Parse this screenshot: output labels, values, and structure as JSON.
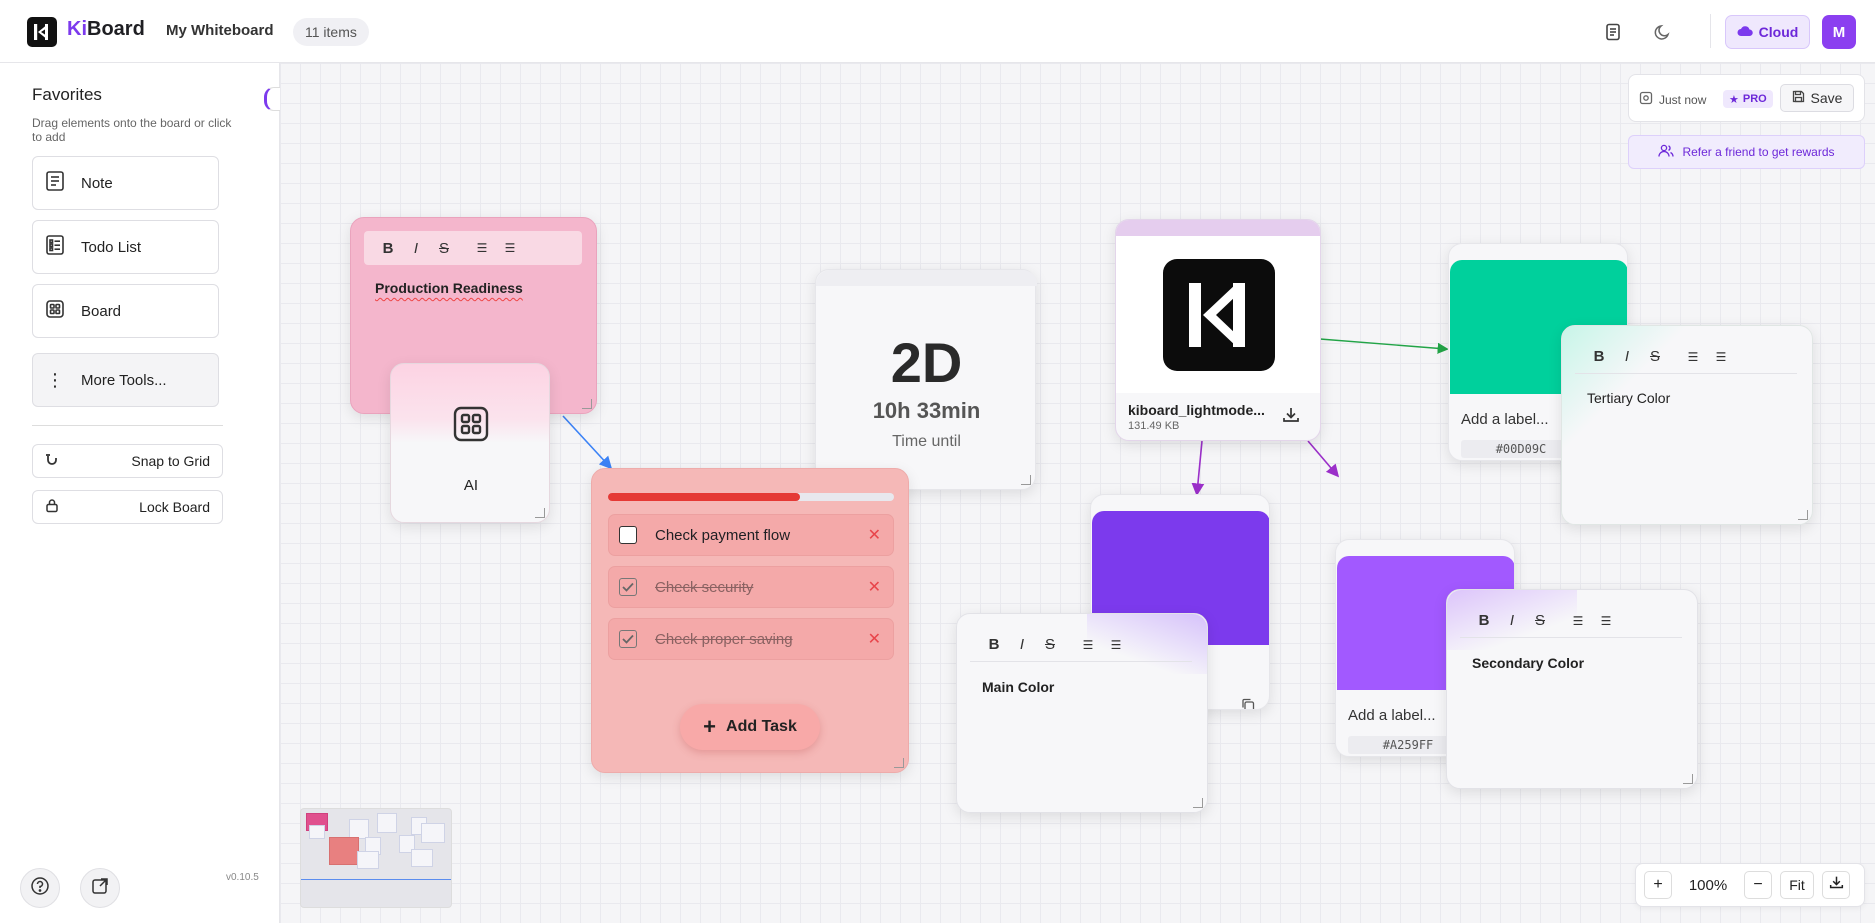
{
  "header": {
    "brand_ki": "Ki",
    "brand_rest": "Board",
    "board_name": "My Whiteboard",
    "items_count": "11 items",
    "cloud_label": "Cloud",
    "avatar_initial": "M"
  },
  "sidebar": {
    "title": "Favorites",
    "hint": "Drag elements onto the board or click to add",
    "tools": [
      {
        "label": "Note",
        "icon": "note-icon"
      },
      {
        "label": "Todo List",
        "icon": "todo-list-icon"
      },
      {
        "label": "Board",
        "icon": "board-icon"
      },
      {
        "label": "More Tools...",
        "icon": "more-vertical-icon"
      }
    ],
    "snap_label": "Snap to Grid",
    "lock_label": "Lock Board",
    "version": "v0.10.5"
  },
  "status": {
    "saved_time": "Just now",
    "pro_label": "PRO",
    "save_label": "Save",
    "refer_label": "Refer a friend to get rewards"
  },
  "canvas": {
    "note_production": {
      "text": "Production Readiness"
    },
    "ai_card": {
      "label": "AI"
    },
    "countdown": {
      "big": "2D",
      "sub": "10h 33min",
      "caption": "Time until"
    },
    "todo": {
      "progress": 0.67,
      "tasks": [
        {
          "label": "Check payment flow",
          "done": false
        },
        {
          "label": "Check security",
          "done": true
        },
        {
          "label": "Check proper saving",
          "done": true
        }
      ],
      "add_label": "Add Task"
    },
    "image_card": {
      "filename": "kiboard_lightmode...",
      "size": "131.49 KB"
    },
    "color_green": {
      "label": "Add a label...",
      "hex": "#00D09C",
      "color": "#00D09C"
    },
    "note_tertiary": {
      "text": "Tertiary Color"
    },
    "color_purple_main": {
      "color": "#7C3AED"
    },
    "note_main": {
      "text": "Main Color"
    },
    "color_purple_secondary": {
      "label": "Add a label...",
      "hex": "#A259FF",
      "color": "#A259FF"
    },
    "note_secondary": {
      "text": "Secondary Color"
    }
  },
  "zoom": {
    "value": "100%",
    "fit_label": "Fit"
  }
}
